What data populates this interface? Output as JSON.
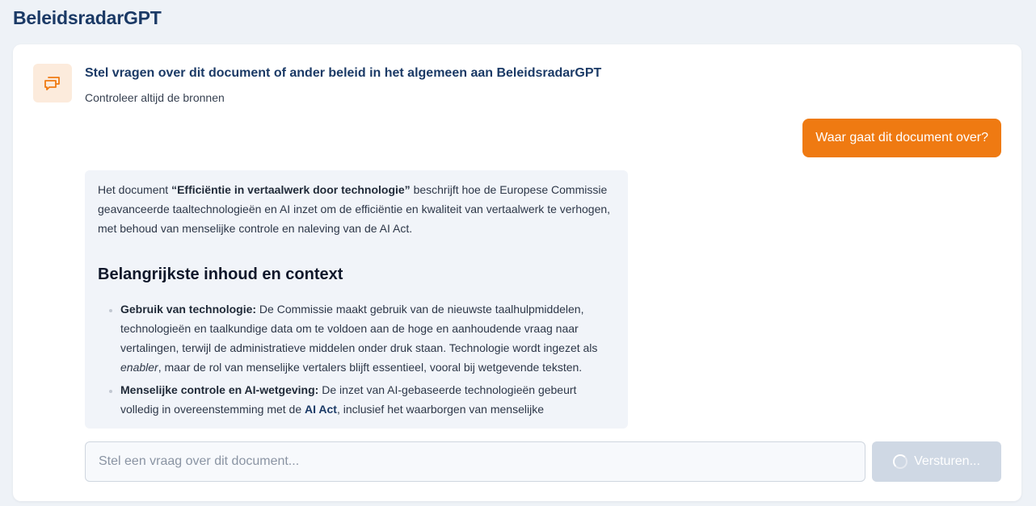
{
  "app": {
    "title": "BeleidsradarGPT"
  },
  "chat_header": {
    "title": "Stel vragen over dit document of ander beleid in het algemeen aan BeleidsradarGPT",
    "subtitle": "Controleer altijd de bronnen",
    "icon": "chat-bubbles-icon"
  },
  "messages": {
    "user": "Waar gaat dit document over?",
    "assistant": {
      "intro_pre": "Het document ",
      "intro_bold": "“Efficiëntie in vertaalwerk door technologie”",
      "intro_post": " beschrijft hoe de Europese Commissie geavanceerde taaltechnologieën en AI inzet om de efficiëntie en kwaliteit van vertaalwerk te verhogen, met behoud van menselijke controle en naleving van de AI Act.",
      "heading": "Belangrijkste inhoud en context",
      "bullets": [
        {
          "label": "Gebruik van technologie:",
          "text_pre": " De Commissie maakt gebruik van de nieuwste taalhulpmiddelen, technologieën en taalkundige data om te voldoen aan de hoge en aanhoudende vraag naar vertalingen, terwijl de administratieve middelen onder druk staan. Technologie wordt ingezet als ",
          "text_em": "enabler",
          "text_post": ", maar de rol van menselijke vertalers blijft essentieel, vooral bij wetgevende teksten."
        },
        {
          "label": "Menselijke controle en AI-wetgeving:",
          "text_pre": " De inzet van AI-gebaseerde technologieën gebeurt volledig in overeenstemming met de ",
          "link": "AI Act",
          "text_post": ", inclusief het waarborgen van menselijke"
        }
      ]
    }
  },
  "composer": {
    "placeholder": "Stel een vraag over dit document...",
    "send_label": "Versturen...",
    "send_state": "loading"
  },
  "colors": {
    "accent": "#ef7a12",
    "title": "#1b3a66",
    "send_disabled": "#cfd8e4"
  }
}
